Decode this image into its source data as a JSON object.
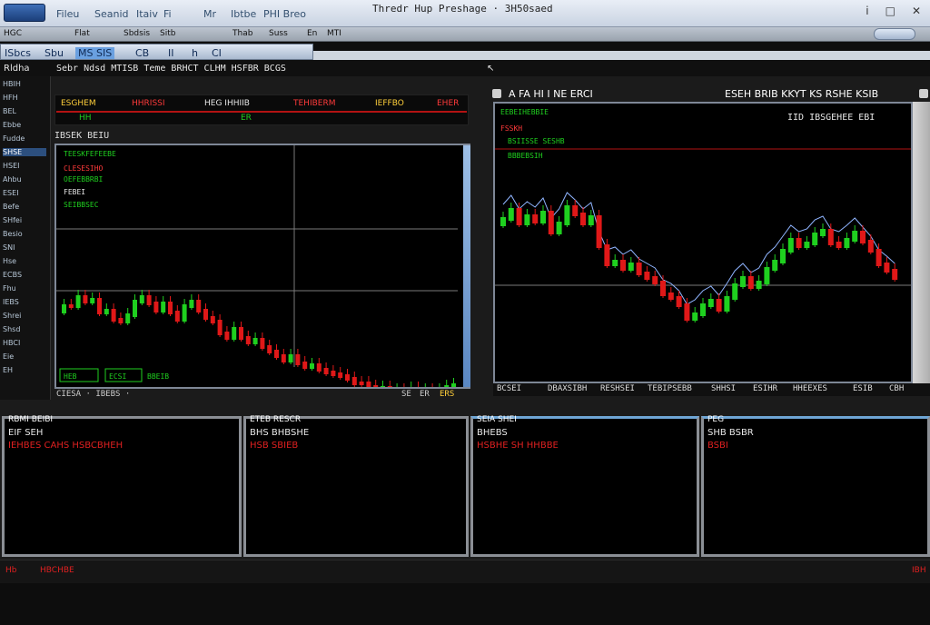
{
  "titlebar": {
    "window_title": "Thredr Hup Preshage · 3H50saed",
    "menu": [
      "Fileu",
      "Seanid",
      "Itaiv",
      "Fi",
      "Mr",
      "Ibtbe",
      "PHI Breo"
    ],
    "controls": [
      "i",
      "□",
      "✕"
    ]
  },
  "toolbar": {
    "items": [
      "HGC",
      "Flat",
      "Sbdsis",
      "Sitb",
      "Thab",
      "Suss",
      "En",
      "MTI"
    ]
  },
  "tabs": {
    "watch_tab": [
      "ISbcs",
      "Sbu",
      "MS SIS",
      "CB",
      "II",
      "h",
      "CI"
    ]
  },
  "header_strip": {
    "left_label": "Rldha",
    "items": "Sebr Ndsd MTISB Teme BRHCT CLHM HSFBR BCGS"
  },
  "sidebar": {
    "items": [
      "HBIH",
      "HFH",
      "BEL",
      "Ebbe",
      "Fudde",
      "SHSE",
      "HSEI",
      "Ahbu",
      "ESEI",
      "Befe",
      "SHfei",
      "Besio",
      "SNI",
      "Hse",
      "ECBS",
      "Fhu",
      "IEBS",
      "Shrei",
      "Shsd",
      "HBCI",
      "Eie",
      "EH"
    ],
    "selected_index": 5
  },
  "ticker": {
    "row1": [
      "ESGHEM",
      "HHRISSI",
      "HEG IHHIIB",
      "TEHIBERM",
      "IEFFBO",
      "EHER"
    ],
    "row2": [
      "HH",
      "ER"
    ]
  },
  "chart1": {
    "header": "IBSEK BEIU",
    "legend": [
      "TEESKFEFEEBE",
      "CLESESIHO",
      "OEFEBBRBI",
      "FEBEI",
      "SEIBBSEC"
    ],
    "footer_left": "CIESA · IBEBS ·",
    "footer_right": [
      "SE",
      "ER",
      "ERS"
    ],
    "labels_bottom": [
      "HEB",
      "ECSI",
      "BBEIB"
    ]
  },
  "chart2": {
    "title_left": "A FA HI I NE ERCI",
    "title_right": "ESEH BRIB KKYT KS RSHE KSIB",
    "sub_right": "IID IBSGEHEE EBI",
    "legend": [
      "EEBEIHEBBIE",
      "FSSKH",
      "BSIISSE SESHB",
      "BBBEBSIH"
    ],
    "footer_items": [
      "BCSEI",
      "DBAXSIBH",
      "RESHSEI",
      "TEBIPSEBB",
      "SHHSI",
      "ESIHR",
      "HHEEXES",
      "ESIB",
      "CBH"
    ],
    "colors": {
      "up": "#1fd01f",
      "down": "#e01818",
      "ma": "#8fb4ff"
    }
  },
  "chart_data": [
    {
      "type": "candlestick",
      "categories_count": 56,
      "values": [
        335,
        335,
        345,
        340,
        342,
        328,
        330,
        320,
        318,
        325,
        340,
        345,
        338,
        330,
        338,
        328,
        320,
        335,
        340,
        330,
        322,
        318,
        305,
        300,
        310,
        300,
        295,
        298,
        290,
        285,
        280,
        275,
        280,
        272,
        268,
        270,
        265,
        262,
        260,
        258,
        255,
        250,
        250,
        246,
        243,
        245,
        241,
        242,
        240,
        244,
        238,
        242,
        240,
        242,
        246,
        248
      ]
    },
    {
      "type": "candlestick",
      "categories_count": 50,
      "values": [
        235,
        225,
        240,
        232,
        238,
        228,
        250,
        240,
        222,
        230,
        240,
        233,
        265,
        285,
        282,
        290,
        285,
        295,
        300,
        305,
        318,
        322,
        330,
        345,
        340,
        330,
        325,
        335,
        322,
        308,
        300,
        310,
        305,
        290,
        282,
        270,
        258,
        265,
        262,
        252,
        248,
        262,
        265,
        258,
        250,
        260,
        270,
        285,
        292,
        300
      ]
    }
  ],
  "panels": [
    {
      "title": "RBMI BEIBI",
      "line1": "EIF SEH",
      "line2": "IEHBES CAHS HSBCBHEH"
    },
    {
      "title": "ETEB RESCR",
      "line1": "BHS BHBSHE",
      "line2": "HSB SBIEB"
    },
    {
      "title": "SEIA SHEI",
      "line1": "BHEBS",
      "line2": "HSBHE SH HHBBE"
    },
    {
      "title": "PEG",
      "line1": "SHB BSBR",
      "line2": "BSBI"
    }
  ],
  "statusbar": {
    "left": "Hb",
    "left2": "HBCHBE",
    "right": "IBH"
  }
}
